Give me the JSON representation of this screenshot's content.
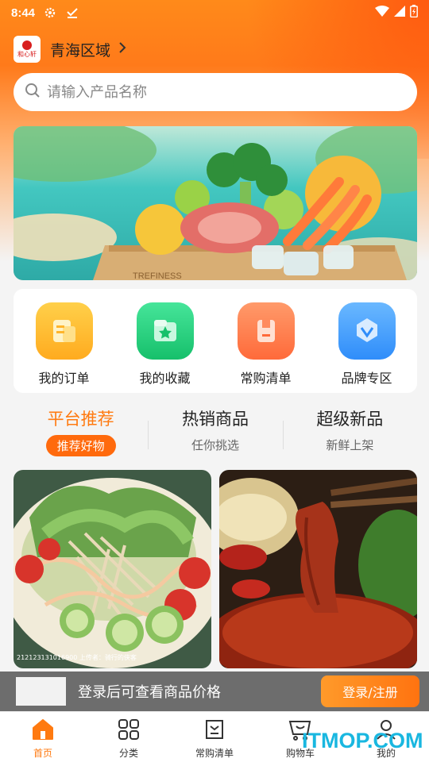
{
  "status": {
    "time": "8:44"
  },
  "header": {
    "region": "青海区域",
    "logo_text": "和心轩"
  },
  "search": {
    "placeholder": "请输入产品名称"
  },
  "banner": {
    "crate_text": "TREFINESS"
  },
  "quick_links": [
    {
      "label": "我的订单",
      "icon": "order-icon",
      "color": "#ffb52b"
    },
    {
      "label": "我的收藏",
      "icon": "favorite-icon",
      "color": "#27d27f"
    },
    {
      "label": "常购清单",
      "icon": "list-icon",
      "color": "#ff7a4d"
    },
    {
      "label": "品牌专区",
      "icon": "brand-icon",
      "color": "#4aa3ff"
    }
  ],
  "tabs": [
    {
      "title": "平台推荐",
      "sub": "推荐好物",
      "active": true
    },
    {
      "title": "热销商品",
      "sub": "任你挑选"
    },
    {
      "title": "超级新品",
      "sub": "新鲜上架"
    }
  ],
  "products": [
    {
      "name": "salad",
      "watermark": "212123131016900 上传者：骑行的侠客"
    },
    {
      "name": "spicy-beef"
    }
  ],
  "login_bar": {
    "text": "登录后可查看商品价格",
    "button": "登录/注册"
  },
  "nav": [
    {
      "label": "首页",
      "icon": "home-icon",
      "active": true
    },
    {
      "label": "分类",
      "icon": "category-icon"
    },
    {
      "label": "常购清单",
      "icon": "list-icon"
    },
    {
      "label": "购物车",
      "icon": "cart-icon"
    },
    {
      "label": "我的",
      "icon": "user-icon"
    }
  ],
  "watermark": "ITMOP.COM",
  "colors": {
    "accent": "#ff7a10",
    "header_top": "#ff8a1a"
  }
}
